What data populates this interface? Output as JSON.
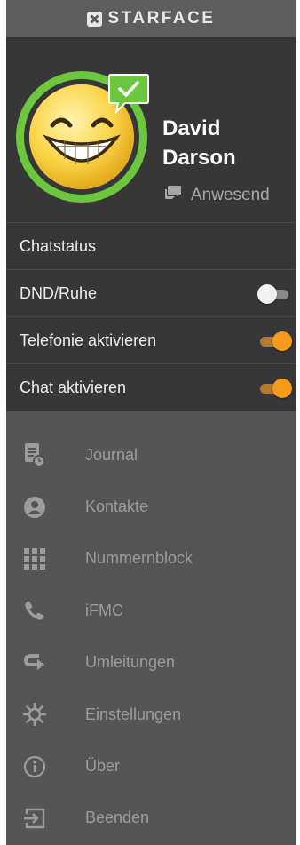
{
  "brand": {
    "name": "STARFACE",
    "logo_icon": "starface-logo-icon"
  },
  "profile": {
    "name": "David Darson",
    "status": "Anwesend",
    "status_icon": "chat-bubble-icon",
    "avatar": "smiley-avatar",
    "presence_badge": "green-check-icon",
    "ring_color": "#6cc63e"
  },
  "settings": {
    "chatstatus": "Chatstatus",
    "dnd": {
      "label": "DND/Ruhe",
      "on": false
    },
    "telefonie": {
      "label": "Telefonie aktivieren",
      "on": true
    },
    "chat": {
      "label": "Chat aktivieren",
      "on": true
    },
    "accent_color": "#f59a1b"
  },
  "menu": [
    {
      "label": "Journal",
      "icon": "journal-icon"
    },
    {
      "label": "Kontakte",
      "icon": "contact-icon"
    },
    {
      "label": "Nummernblock",
      "icon": "dialpad-icon"
    },
    {
      "label": "iFMC",
      "icon": "phone-icon"
    },
    {
      "label": "Umleitungen",
      "icon": "redirect-icon"
    },
    {
      "label": "Einstellungen",
      "icon": "gear-icon"
    },
    {
      "label": "Über",
      "icon": "info-icon"
    },
    {
      "label": "Beenden",
      "icon": "exit-icon"
    }
  ]
}
